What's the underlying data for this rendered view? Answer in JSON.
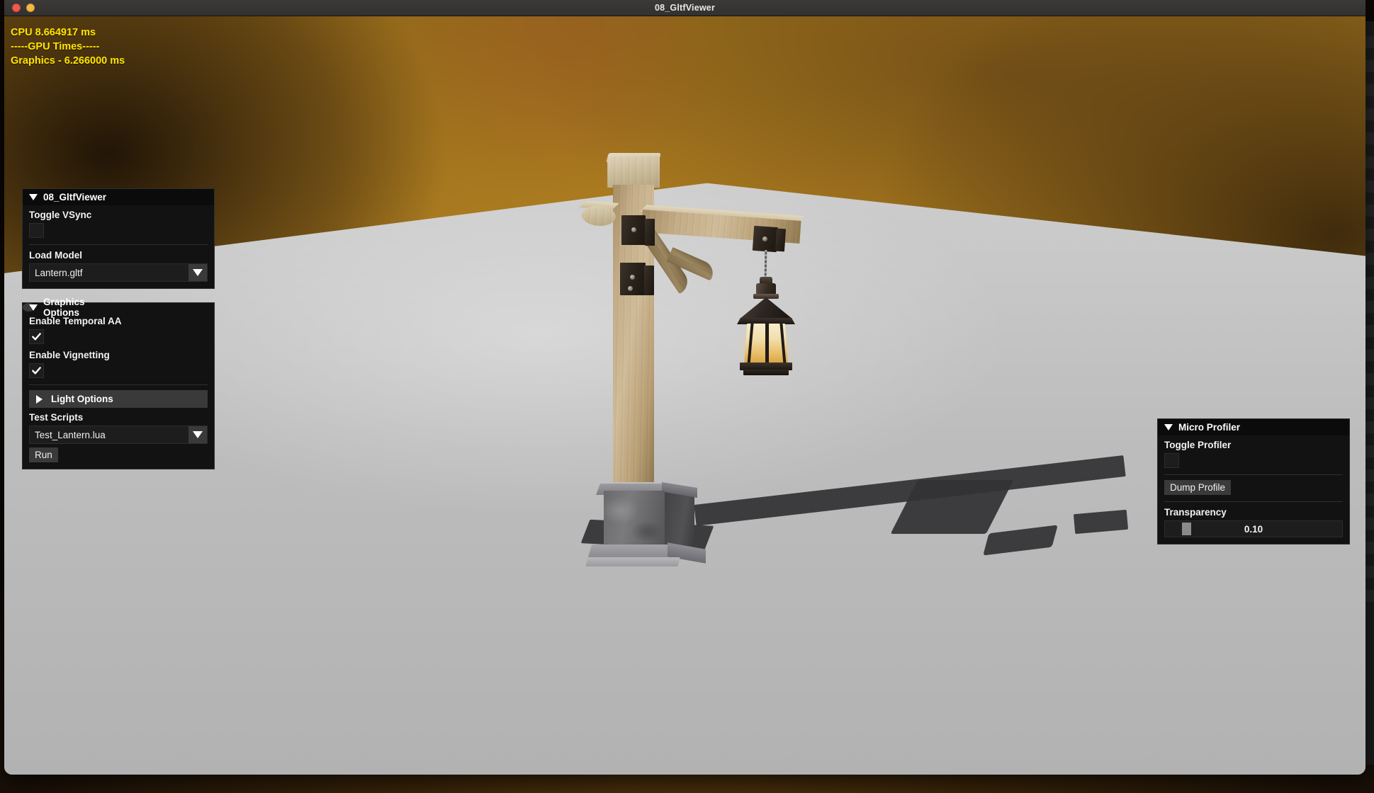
{
  "window": {
    "title": "08_GltfViewer",
    "traffic_lights": [
      {
        "name": "close",
        "color": "#f2594b"
      },
      {
        "name": "minimize",
        "color": "#f4b740"
      }
    ]
  },
  "stats_overlay": {
    "cpu_line": "CPU 8.664917 ms",
    "gpu_header": "-----GPU Times-----",
    "graphics_line": "Graphics - 6.266000 ms",
    "color": "#ffe500"
  },
  "panels": {
    "app": {
      "title": "08_GltfViewer",
      "collapse_state": "expanded",
      "vsync": {
        "label": "Toggle VSync",
        "checked": false
      },
      "load_model": {
        "label": "Load Model",
        "value": "Lantern.gltf"
      }
    },
    "graphics": {
      "title": "Graphics Options",
      "collapse_state": "expanded",
      "temporal_aa": {
        "label": "Enable Temporal AA",
        "checked": true
      },
      "vignetting": {
        "label": "Enable Vignetting",
        "checked": true
      },
      "light_options": {
        "label": "Light Options",
        "collapse_state": "collapsed"
      },
      "test_scripts": {
        "label": "Test Scripts",
        "value": "Test_Lantern.lua"
      },
      "run_button": "Run"
    },
    "profiler": {
      "title": "Micro Profiler",
      "collapse_state": "expanded",
      "toggle_profiler": {
        "label": "Toggle Profiler",
        "checked": false
      },
      "dump_profile_button": "Dump Profile",
      "transparency": {
        "label": "Transparency",
        "value": "0.10",
        "fill_percent": 10
      }
    }
  },
  "background_window": {
    "lines": [
      "e",
      "",
      "np",
      "",
      "efa",
      "",
      "lat",
      "/sm",
      "de",
      "np",
      "ers",
      "ll/T",
      "t_T",
      "_Gl",
      "np",
      "",
      "ou",
      "",
      "",
      "",
      "Lo",
      "",
      "chi",
      "",
      "ev",
      "ev",
      "",
      "",
      "",
      "",
      "",
      "",
      "nic",
      "E",
      "",
      "ac",
      "",
      "T",
      "Wr",
      "",
      "",
      "",
      "",
      "",
      "",
      "",
      "",
      "",
      ""
    ]
  },
  "colors": {
    "panel_bg": "#121212",
    "panel_header_dark": "#0b0b0b",
    "panel_header_light": "#3a3a3a",
    "accent_widget": "#3a3a3a",
    "text": "#f0f0f0",
    "ground": "#cfcfcf",
    "sky": "#b5821f"
  },
  "scene": {
    "model": "Lantern.gltf",
    "description": "wooden lamp post with hanging lantern on gray ground plane"
  }
}
